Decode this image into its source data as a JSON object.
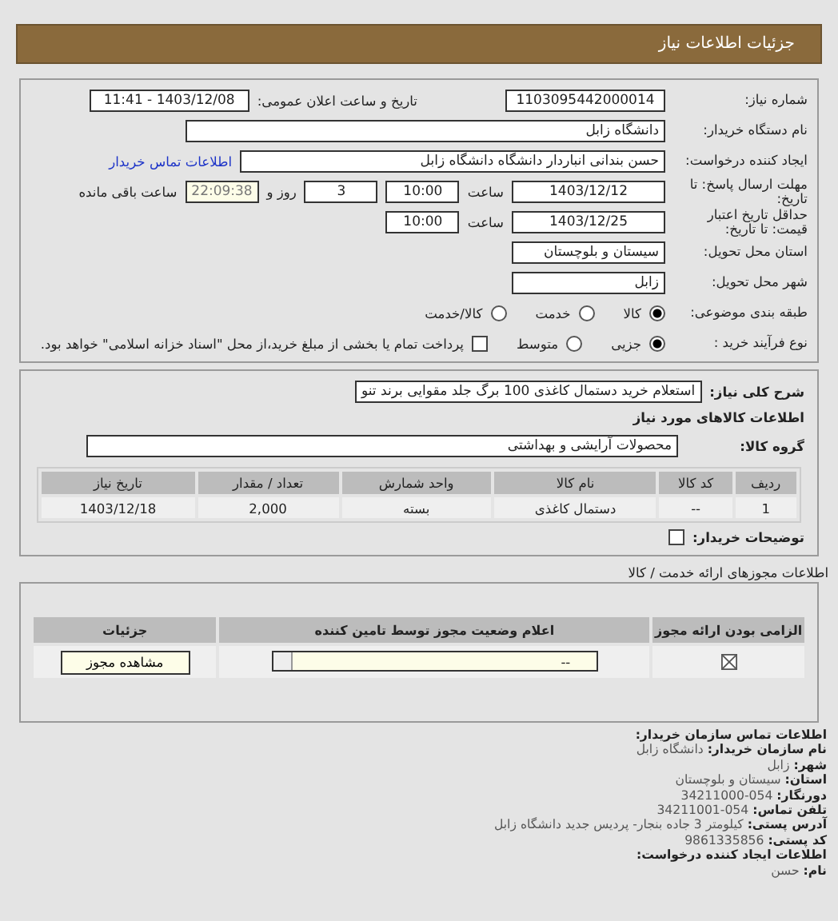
{
  "header": {
    "title": "جزئیات اطلاعات نیاز"
  },
  "details": {
    "need_number": {
      "label": "شماره نیاز:",
      "value": "1103095442000014"
    },
    "announce": {
      "label": "تاریخ و ساعت اعلان عمومی:",
      "value": "1403/12/08 - 11:41"
    },
    "buyer": {
      "label": "نام دستگاه خریدار:",
      "value": "دانشگاه زابل"
    },
    "creator": {
      "label": "ایجاد کننده درخواست:",
      "value": "حسن بندانی انباردار دانشگاه دانشگاه زابل",
      "link": "اطلاعات تماس خریدار"
    },
    "deadline": {
      "label": "مهلت ارسال پاسخ: تا تاریخ:",
      "date": "1403/12/12",
      "time_label": "ساعت",
      "time": "10:00",
      "days": "3",
      "days_label": "روز و",
      "remaining": "22:09:38",
      "remaining_label": "ساعت باقی مانده"
    },
    "validity": {
      "label": "حداقل تاریخ اعتبار قیمت: تا تاریخ:",
      "date": "1403/12/25",
      "time_label": "ساعت",
      "time": "10:00"
    },
    "province": {
      "label": "استان محل تحویل:",
      "value": "سیستان و بلوچستان"
    },
    "city": {
      "label": "شهر محل تحویل:",
      "value": "زابل"
    },
    "category": {
      "label": "طبقه بندی موضوعی:",
      "options": [
        {
          "label": "کالا",
          "selected": true
        },
        {
          "label": "خدمت",
          "selected": false
        },
        {
          "label": "کالا/خدمت",
          "selected": false
        }
      ]
    },
    "process": {
      "label": "نوع فرآیند خرید :",
      "options": [
        {
          "label": "جزیی",
          "selected": true
        },
        {
          "label": "متوسط",
          "selected": false
        }
      ],
      "payment": {
        "label": "پرداخت تمام یا بخشی از مبلغ خرید،از محل \"اسناد خزانه اسلامی\" خواهد بود.",
        "checked": false
      }
    }
  },
  "goods": {
    "description": {
      "label": "شرح کلی نیاز:",
      "value": "استعلام خرید دستمال کاغذی 100 برگ جلد مقوایی برند تنو"
    },
    "title": "اطلاعات کالاهای مورد نیاز",
    "group": {
      "label": "گروه کالا:",
      "value": "محصولات آرایشی و بهداشتی"
    },
    "table": {
      "columns": [
        "ردیف",
        "کد کالا",
        "نام کالا",
        "واحد شمارش",
        "تعداد / مقدار",
        "تاریخ نیاز"
      ],
      "rows": [
        [
          "1",
          "--",
          "دستمال کاغذی",
          "بسته",
          "2,000",
          "1403/12/18"
        ]
      ]
    },
    "notes": {
      "label": "توضیحات خریدار:",
      "checked": false
    }
  },
  "licenses": {
    "title": "اطلاعات مجوزهای ارائه خدمت / کالا",
    "columns": [
      "الزامی بودن ارائه مجوز",
      "اعلام وضعیت مجوز توسط تامین کننده",
      "جزئیات"
    ],
    "rows": [
      {
        "required": true,
        "status": "--",
        "button": "مشاهده مجوز"
      }
    ]
  },
  "contact": {
    "title": "اطلاعات تماس سازمان خریدار:",
    "lines": [
      {
        "label": "نام سازمان خریدار:",
        "value": "دانشگاه زابل"
      },
      {
        "label": "شهر:",
        "value": "زابل"
      },
      {
        "label": "استان:",
        "value": "سیستان و بلوچستان"
      },
      {
        "label": "دورنگار:",
        "value": "054-34211000"
      },
      {
        "label": "تلفن تماس:",
        "value": "054-34211001"
      },
      {
        "label": "آدرس پستی:",
        "value": "کیلومتر 3 جاده بنجار- پردیس جدید دانشگاه زابل"
      },
      {
        "label": "کد پستی:",
        "value": "9861335856"
      }
    ],
    "creator_title": "اطلاعات ایجاد کننده درخواست:",
    "creator_lines": [
      {
        "label": "نام:",
        "value": "حسن"
      }
    ]
  }
}
